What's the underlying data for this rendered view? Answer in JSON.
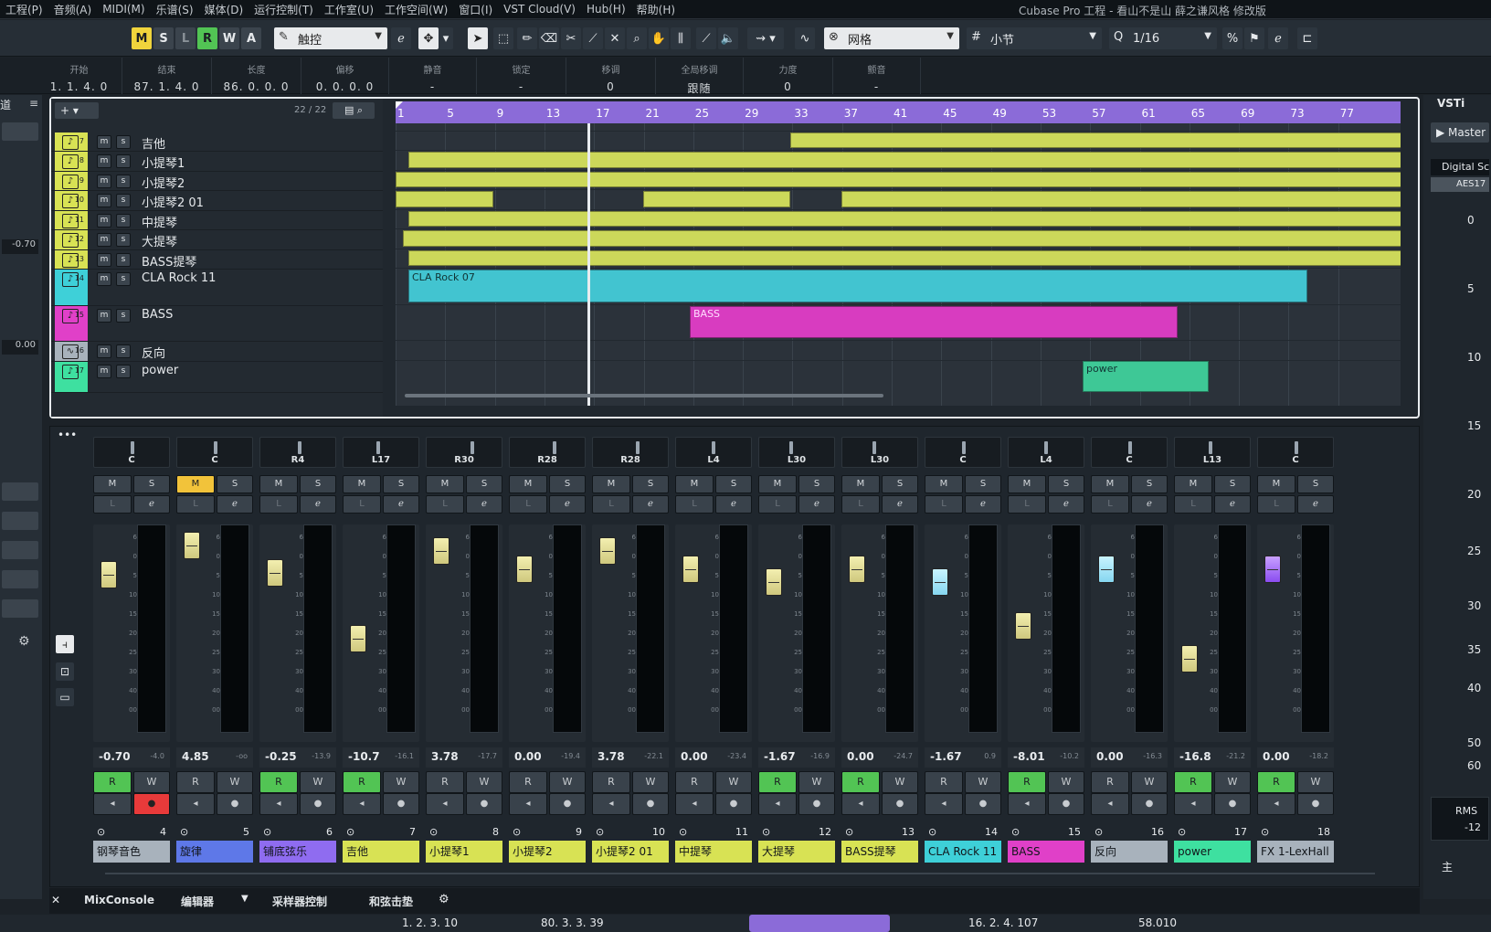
{
  "menu": [
    "工程(P)",
    "音频(A)",
    "MIDI(M)",
    "乐谱(S)",
    "媒体(D)",
    "运行控制(T)",
    "工作室(U)",
    "工作空间(W)",
    "窗口(I)",
    "VST Cloud(V)",
    "Hub(H)",
    "帮助(H)"
  ],
  "window_title": "Cubase Pro 工程 - 看山不是山 薛之谦风格 修改版",
  "toolbar": {
    "modes": [
      "M",
      "S",
      "L",
      "R",
      "W",
      "A"
    ],
    "automation_mode": "触控",
    "snap_type": "网格",
    "grid_type": "小节",
    "quantize": "1/16"
  },
  "infoline": [
    {
      "label": "开始",
      "value": "1. 1. 4. 0"
    },
    {
      "label": "结束",
      "value": "87. 1. 4. 0"
    },
    {
      "label": "长度",
      "value": "86. 0. 0. 0"
    },
    {
      "label": "偏移",
      "value": "0. 0. 0. 0"
    },
    {
      "label": "静音",
      "value": "-"
    },
    {
      "label": "锁定",
      "value": "-"
    },
    {
      "label": "移调",
      "value": "0"
    },
    {
      "label": "全局移调",
      "value": "跟随"
    },
    {
      "label": "力度",
      "value": "0"
    },
    {
      "label": "颤音",
      "value": "-"
    }
  ],
  "tracklist": {
    "count": "22 / 22",
    "tracks": [
      {
        "num": "7",
        "name": "吉他",
        "color": "#d8e254",
        "type": "midi"
      },
      {
        "num": "8",
        "name": "小提琴1",
        "color": "#d8e254",
        "type": "midi"
      },
      {
        "num": "9",
        "name": "小提琴2",
        "color": "#d8e254",
        "type": "midi"
      },
      {
        "num": "10",
        "name": "小提琴2 01",
        "color": "#d8e254",
        "type": "midi"
      },
      {
        "num": "11",
        "name": "中提琴",
        "color": "#d8e254",
        "type": "midi"
      },
      {
        "num": "12",
        "name": "大提琴",
        "color": "#d8e254",
        "type": "midi"
      },
      {
        "num": "13",
        "name": "BASS提琴",
        "color": "#d8e254",
        "type": "midi"
      },
      {
        "num": "14",
        "name": "CLA Rock 11",
        "color": "#3ed0d8",
        "type": "midi"
      },
      {
        "num": "15",
        "name": "BASS",
        "color": "#e040c8",
        "type": "midi"
      },
      {
        "num": "16",
        "name": "反向",
        "color": "#a8b2bc",
        "type": "audio"
      },
      {
        "num": "17",
        "name": "power",
        "color": "#3ee0a0",
        "type": "midi"
      }
    ]
  },
  "ruler": [
    "1",
    "5",
    "9",
    "13",
    "17",
    "21",
    "25",
    "29",
    "33",
    "37",
    "41",
    "45",
    "49",
    "53",
    "57",
    "61",
    "65",
    "69",
    "73",
    "77"
  ],
  "parts": {
    "cla": "CLA Rock 07",
    "bass": "BASS",
    "power": "power"
  },
  "mixer": {
    "strips": [
      {
        "pan": "C",
        "vol": "-0.70",
        "peak": "-4.0",
        "num": "4",
        "name": "钢琴音色",
        "color": "#a8b2bc",
        "mute": false,
        "r": true,
        "w": true
      },
      {
        "pan": "C",
        "vol": "4.85",
        "peak": "-oo",
        "num": "5",
        "name": "旋律",
        "color": "#5e78e8",
        "mute": true,
        "r": false,
        "w": false
      },
      {
        "pan": "R4",
        "vol": "-0.25",
        "peak": "-13.9",
        "num": "6",
        "name": "铺底弦乐",
        "color": "#8f6cf0",
        "mute": false,
        "r": true,
        "w": false
      },
      {
        "pan": "L17",
        "vol": "-10.7",
        "peak": "-16.1",
        "num": "7",
        "name": "吉他",
        "color": "#d8e254",
        "mute": false,
        "r": true,
        "w": false
      },
      {
        "pan": "R30",
        "vol": "3.78",
        "peak": "-17.7",
        "num": "8",
        "name": "小提琴1",
        "color": "#d8e254",
        "mute": false,
        "r": false,
        "w": false
      },
      {
        "pan": "R28",
        "vol": "0.00",
        "peak": "-19.4",
        "num": "9",
        "name": "小提琴2",
        "color": "#d8e254",
        "mute": false,
        "r": false,
        "w": false
      },
      {
        "pan": "R28",
        "vol": "3.78",
        "peak": "-22.1",
        "num": "10",
        "name": "小提琴2 01",
        "color": "#d8e254",
        "mute": false,
        "r": false,
        "w": false
      },
      {
        "pan": "L4",
        "vol": "0.00",
        "peak": "-23.4",
        "num": "11",
        "name": "中提琴",
        "color": "#d8e254",
        "mute": false,
        "r": false,
        "w": false
      },
      {
        "pan": "L30",
        "vol": "-1.67",
        "peak": "-16.9",
        "num": "12",
        "name": "大提琴",
        "color": "#d8e254",
        "mute": false,
        "r": true,
        "w": false
      },
      {
        "pan": "L30",
        "vol": "0.00",
        "peak": "-24.7",
        "num": "13",
        "name": "BASS提琴",
        "color": "#d8e254",
        "mute": false,
        "r": true,
        "w": false
      },
      {
        "pan": "C",
        "vol": "-1.67",
        "peak": "0.9",
        "num": "14",
        "name": "CLA Rock 11",
        "color": "#3ed0d8",
        "mute": false,
        "r": false,
        "w": false
      },
      {
        "pan": "L4",
        "vol": "-8.01",
        "peak": "-10.2",
        "num": "15",
        "name": "BASS",
        "color": "#e040c8",
        "mute": false,
        "r": true,
        "w": false
      },
      {
        "pan": "C",
        "vol": "0.00",
        "peak": "-16.3",
        "num": "16",
        "name": "反向",
        "color": "#a8b2bc",
        "mute": false,
        "r": false,
        "w": false
      },
      {
        "pan": "L13",
        "vol": "-16.8",
        "peak": "-21.2",
        "num": "17",
        "name": "power",
        "color": "#3ee0a0",
        "mute": false,
        "r": true,
        "w": false
      },
      {
        "pan": "C",
        "vol": "0.00",
        "peak": "-18.2",
        "num": "18",
        "name": "FX 1-LexHall",
        "color": "#a8b2bc",
        "mute": false,
        "r": true,
        "w": false
      }
    ],
    "scale": [
      "6",
      "0",
      "5",
      "10",
      "15",
      "20",
      "25",
      "30",
      "40",
      "00"
    ]
  },
  "bottom_tabs": [
    "MixConsole",
    "编辑器",
    "采样器控制",
    "和弦击垫"
  ],
  "right_panel": {
    "tab": "VSTi",
    "master": "Master",
    "digital": "Digital Sc",
    "aes": "AES17",
    "scale": [
      "0",
      "5",
      "10",
      "15",
      "20",
      "25",
      "30",
      "35",
      "40",
      "50",
      "60"
    ],
    "rms": "RMS",
    "rms_val": "-12",
    "main": "主"
  },
  "transport": {
    "left_loc": "1. 2. 3. 10",
    "right_loc": "80. 3. 3. 39",
    "pos": "16. 2. 4. 107",
    "tempo": "58.010"
  }
}
